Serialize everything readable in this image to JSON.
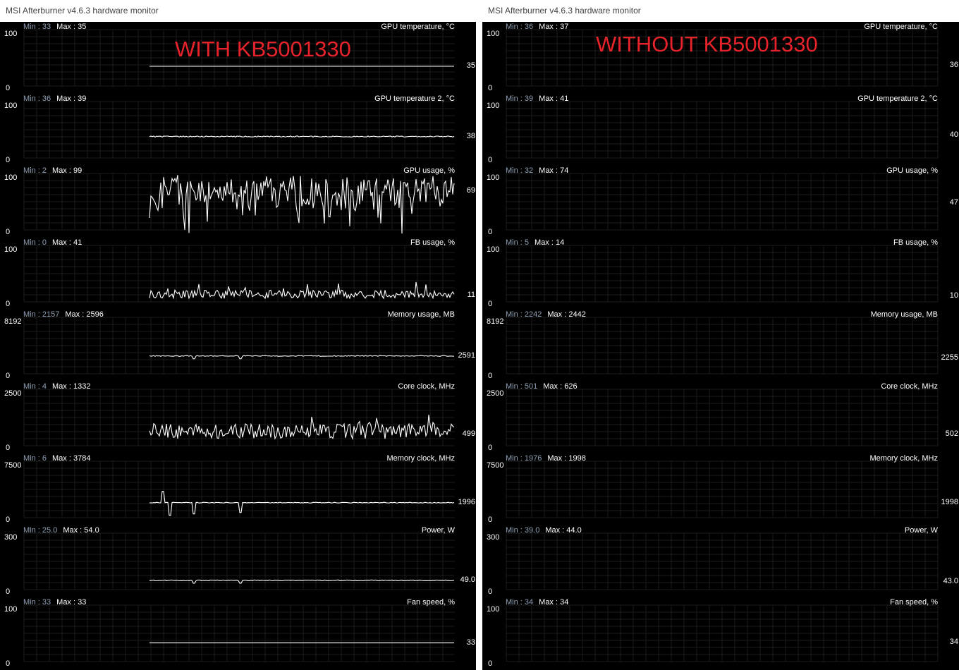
{
  "windows": [
    {
      "title": "MSI Afterburner v4.6.3 hardware monitor",
      "annotation": "WITH KB5001330",
      "graphs": [
        {
          "title": "GPU temperature, °C",
          "min": "33",
          "max": "35",
          "ymax": "100",
          "ymin": "0",
          "current": "35",
          "value": 35,
          "scale": 100,
          "pattern": "flat"
        },
        {
          "title": "GPU temperature 2, °C",
          "min": "36",
          "max": "39",
          "ymax": "100",
          "ymin": "0",
          "current": "38",
          "value": 38,
          "scale": 100,
          "pattern": "flat_noise"
        },
        {
          "title": "GPU usage, %",
          "min": "2",
          "max": "99",
          "ymax": "100",
          "ymin": "0",
          "current": "69",
          "value": 69,
          "scale": 100,
          "pattern": "wild"
        },
        {
          "title": "FB usage, %",
          "min": "0",
          "max": "41",
          "ymax": "100",
          "ymin": "0",
          "current": "11",
          "value": 11,
          "scale": 100,
          "pattern": "noisy_low"
        },
        {
          "title": "Memory usage, MB",
          "min": "2157",
          "max": "2596",
          "ymax": "8192",
          "ymin": "0",
          "current": "2591",
          "value": 2591,
          "scale": 8192,
          "pattern": "dips"
        },
        {
          "title": "Core clock, MHz",
          "min": "4",
          "max": "1332",
          "ymax": "2500",
          "ymin": "0",
          "current": "499",
          "value": 499,
          "scale": 2500,
          "pattern": "spiky"
        },
        {
          "title": "Memory clock, MHz",
          "min": "6",
          "max": "3784",
          "ymax": "7500",
          "ymin": "0",
          "current": "1996",
          "value": 1996,
          "scale": 7500,
          "pattern": "memclock"
        },
        {
          "title": "Power, W",
          "min": "25.0",
          "max": "54.0",
          "ymax": "300",
          "ymin": "0",
          "current": "49.0",
          "value": 49,
          "scale": 300,
          "pattern": "dips"
        },
        {
          "title": "Fan speed, %",
          "min": "33",
          "max": "33",
          "ymax": "100",
          "ymin": "0",
          "current": "33",
          "value": 33,
          "scale": 100,
          "pattern": "flat"
        }
      ]
    },
    {
      "title": "MSI Afterburner v4.6.3 hardware monitor",
      "annotation": "WITHOUT KB5001330",
      "graphs": [
        {
          "title": "GPU temperature, °C",
          "min": "36",
          "max": "37",
          "ymax": "100",
          "ymin": "0",
          "current": "36",
          "value": 36,
          "scale": 100,
          "pattern": "flat_noise"
        },
        {
          "title": "GPU temperature 2, °C",
          "min": "39",
          "max": "41",
          "ymax": "100",
          "ymin": "0",
          "current": "40",
          "value": 40,
          "scale": 100,
          "pattern": "flat"
        },
        {
          "title": "GPU usage, %",
          "min": "32",
          "max": "74",
          "ymax": "100",
          "ymin": "0",
          "current": "47",
          "value": 47,
          "scale": 100,
          "pattern": "osc"
        },
        {
          "title": "FB usage, %",
          "min": "5",
          "max": "14",
          "ymax": "100",
          "ymin": "0",
          "current": "10",
          "value": 10,
          "scale": 100,
          "pattern": "osc_small"
        },
        {
          "title": "Memory usage, MB",
          "min": "2242",
          "max": "2442",
          "ymax": "8192",
          "ymin": "0",
          "current": "2255",
          "value": 2255,
          "scale": 8192,
          "pattern": "flat_noise"
        },
        {
          "title": "Core clock, MHz",
          "min": "501",
          "max": "626",
          "ymax": "2500",
          "ymin": "0",
          "current": "502",
          "value": 502,
          "scale": 2500,
          "pattern": "flat_blip"
        },
        {
          "title": "Memory clock, MHz",
          "min": "1976",
          "max": "1998",
          "ymax": "7500",
          "ymin": "0",
          "current": "1998",
          "value": 1998,
          "scale": 7500,
          "pattern": "flat"
        },
        {
          "title": "Power, W",
          "min": "39.0",
          "max": "44.0",
          "ymax": "300",
          "ymin": "0",
          "current": "43.0",
          "value": 43,
          "scale": 300,
          "pattern": "flat_noise"
        },
        {
          "title": "Fan speed, %",
          "min": "34",
          "max": "34",
          "ymax": "100",
          "ymin": "0",
          "current": "34",
          "value": 34,
          "scale": 100,
          "pattern": "flat"
        }
      ]
    }
  ],
  "labels": {
    "min": "Min : ",
    "max": "Max : "
  }
}
